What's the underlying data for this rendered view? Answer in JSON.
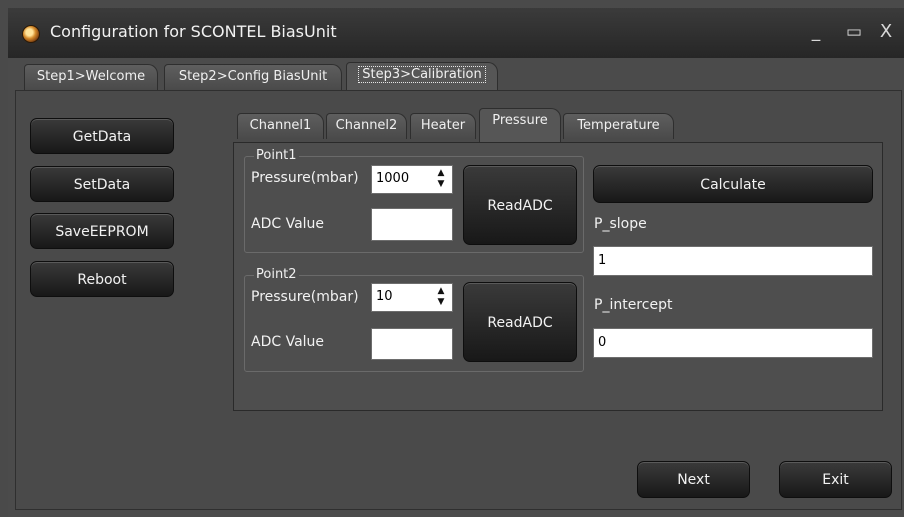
{
  "window": {
    "title": "Configuration for SCONTEL BiasUnit",
    "icon": "app-icon",
    "controls": {
      "minimize": "_",
      "maximize": "▭",
      "close": "X"
    }
  },
  "steps": {
    "tabs": [
      "Step1>Welcome",
      "Step2>Config BiasUnit",
      "Step3>Calibration"
    ],
    "active": "Step3>Calibration"
  },
  "sidebar": {
    "get_data": "GetData",
    "set_data": "SetData",
    "save_eeprom": "SaveEEPROM",
    "reboot": "Reboot"
  },
  "calib": {
    "tabs": [
      "Channel1",
      "Channel2",
      "Heater",
      "Pressure",
      "Temperature"
    ],
    "active": "Pressure"
  },
  "point1": {
    "title": "Point1",
    "pressure_label": "Pressure(mbar)",
    "pressure_value": "1000",
    "adc_label": "ADC Value",
    "adc_value": "",
    "read_button": "ReadADC"
  },
  "point2": {
    "title": "Point2",
    "pressure_label": "Pressure(mbar)",
    "pressure_value": "10",
    "adc_label": "ADC Value",
    "adc_value": "",
    "read_button": "ReadADC"
  },
  "results": {
    "calculate": "Calculate",
    "slope_label": "P_slope",
    "slope_value": "1",
    "intercept_label": "P_intercept",
    "intercept_value": "0"
  },
  "footer": {
    "next": "Next",
    "exit": "Exit"
  }
}
